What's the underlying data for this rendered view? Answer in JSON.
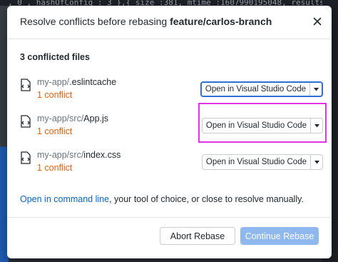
{
  "window": {
    "title_prefix": "Resolve conflicts before rebasing",
    "branch": "feature/carlos-branch"
  },
  "background": {
    "code_lines": [
      "",
      "",
      "",
      "",
      "",
      "",
      "",
      "",
      "",
      "",
      "",
      "",
      "",
      "",
      "",
      ""
    ],
    "top_strip_text": ", 0 , hashOfConfig : 3 },{ size :381, mtime :1607990195048, results :"
  },
  "conflicts": {
    "count_label": "3 conflicted files",
    "files": [
      {
        "dir": "my-app/",
        "name": ".eslintcache",
        "status": "1 conflict",
        "action": "Open in Visual Studio Code"
      },
      {
        "dir": "my-app/src/",
        "name": "App.js",
        "status": "1 conflict",
        "action": "Open in Visual Studio Code"
      },
      {
        "dir": "my-app/src/",
        "name": "index.css",
        "status": "1 conflict",
        "action": "Open in Visual Studio Code"
      }
    ]
  },
  "instructions": {
    "link": "Open in command line",
    "rest": ", your tool of choice, or close to resolve manually."
  },
  "footer": {
    "abort_label": "Abort Rebase",
    "continue_label": "Continue Rebase"
  },
  "colors": {
    "link": "#0366d6",
    "conflict": "#e36209",
    "primary_disabled": "#8fb8ee",
    "highlight": "#e233e4",
    "focus": "#2f6fdc"
  },
  "icons": {
    "close": "close-icon",
    "file": "file-diff-icon",
    "dropdown": "caret-down-icon"
  }
}
